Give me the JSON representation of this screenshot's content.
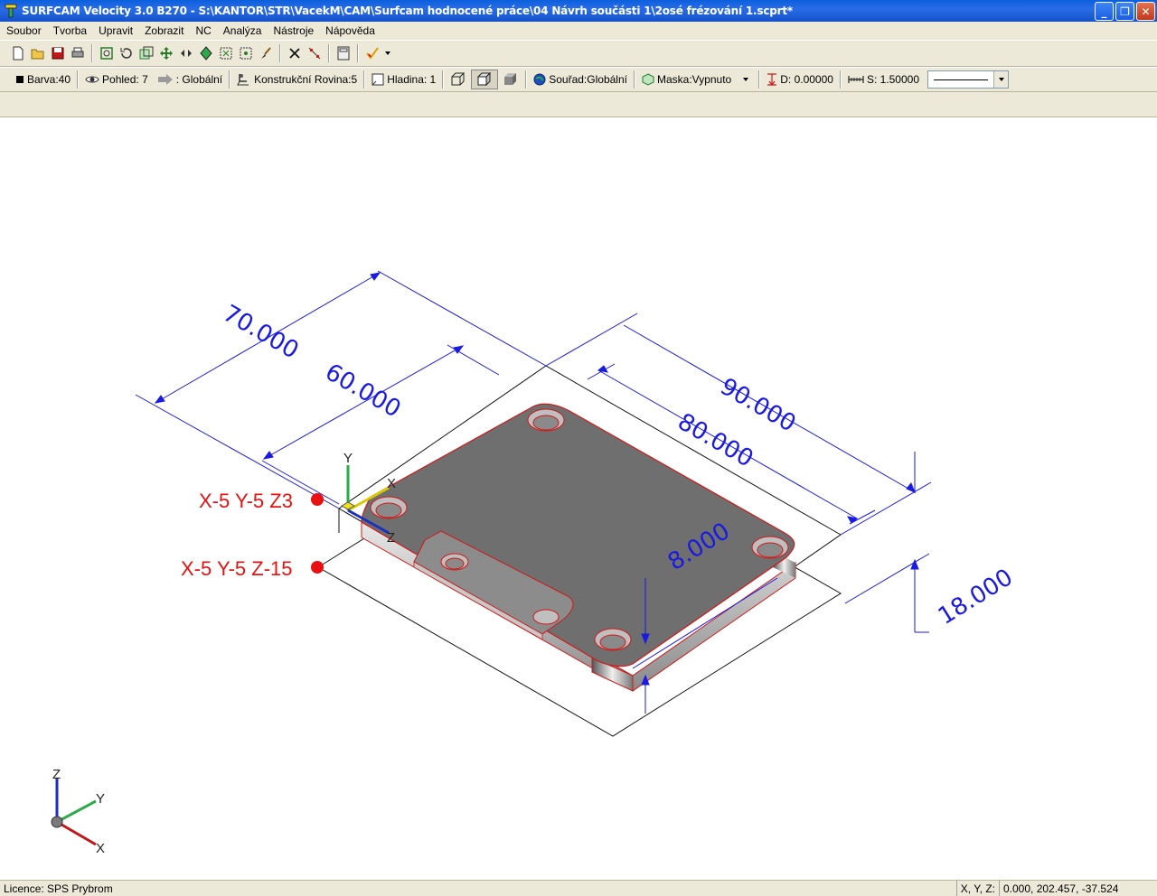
{
  "window": {
    "title": "SURFCAM Velocity 3.0 B270 - S:\\KANTOR\\STR\\VacekM\\CAM\\Surfcam hodnocené práce\\04 Návrh součásti 1\\2osé frézování 1.scprt*",
    "minimize": "_",
    "restore": "❐",
    "close": "✕"
  },
  "menu": {
    "items": [
      "Soubor",
      "Tvorba",
      "Upravit",
      "Zobrazit",
      "NC",
      "Analýza",
      "Nástroje",
      "Nápověda"
    ]
  },
  "toolbar2": {
    "color": "Barva:40",
    "view": "Pohled: 7",
    "cplane_prefix": ": Globální",
    "construction_plane": "Konstrukční Rovina:5",
    "layer": "Hladina: 1",
    "coordinates": "Souřad:Globální",
    "mask": "Maska:Vypnuto",
    "depth": "D: 0.00000",
    "spacing": "S: 1.50000"
  },
  "viewport": {
    "dimensions": [
      "70.000",
      "60.000",
      "90.000",
      "80.000",
      "8.000",
      "18.000"
    ],
    "points": [
      "X-5 Y-5 Z3",
      "X-5 Y-5 Z-15"
    ],
    "part_axes": [
      "Y",
      "X",
      "Z"
    ],
    "world_axes": [
      "Z",
      "Y",
      "X"
    ],
    "colors": {
      "dimension": "#1a1ae0",
      "point": "#e81010",
      "part_fill": "#6f6f6f",
      "part_edge": "#d01818"
    }
  },
  "status": {
    "licence": "Licence: SPS Prybrom",
    "coord_label": "X, Y, Z:",
    "coord_value": "0.000, 202.457, -37.524"
  }
}
